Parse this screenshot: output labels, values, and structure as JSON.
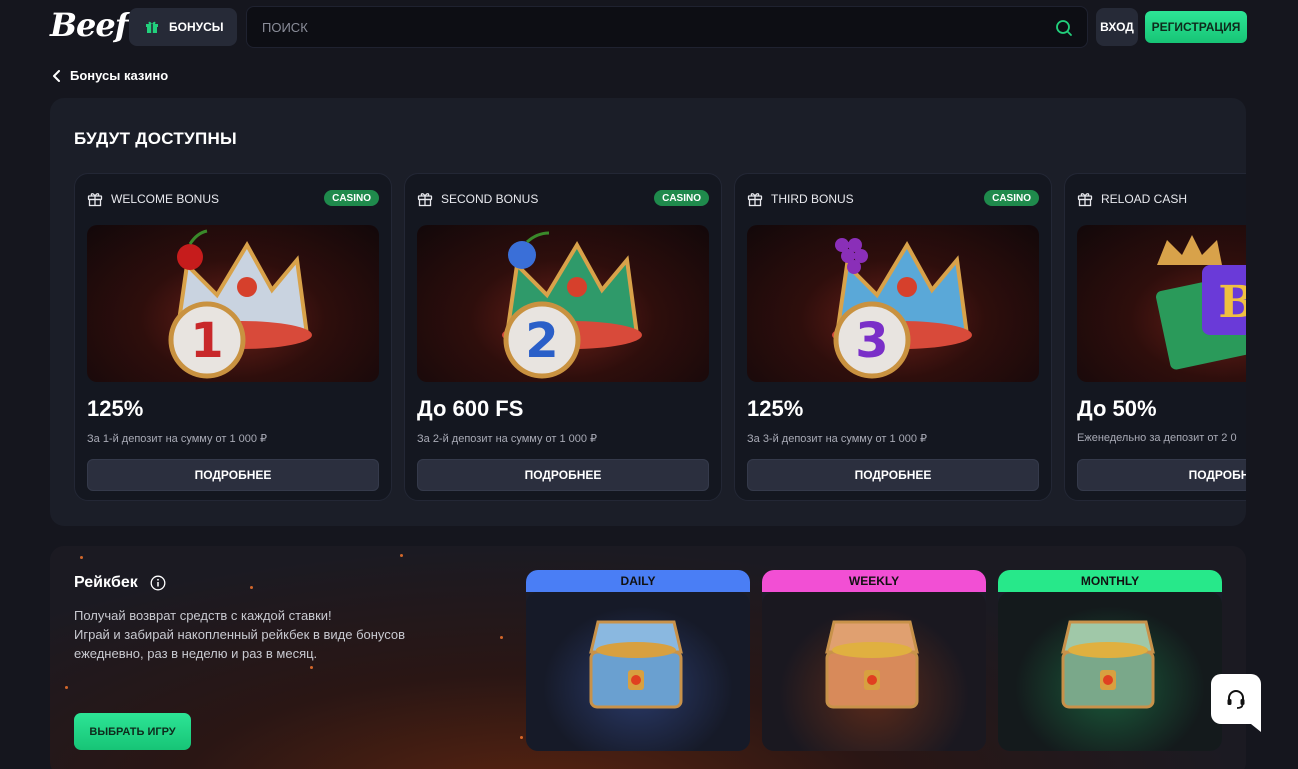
{
  "header": {
    "logo": "Beef",
    "bonuses_label": "БОНУСЫ",
    "search_placeholder": "ПОИСК",
    "login_label": "ВХОД",
    "register_label": "РЕГИСТРАЦИЯ"
  },
  "breadcrumb": {
    "back_label": "Бонусы казино"
  },
  "upcoming": {
    "title": "БУДУТ ДОСТУПНЫ",
    "cards": [
      {
        "name": "WELCOME BONUS",
        "badge": "CASINO",
        "amount": "125%",
        "desc": "За 1-й депозит на сумму от 1 000 ₽",
        "button": "ПОДРОБНЕЕ",
        "numeral": "1",
        "fruit": "cherry"
      },
      {
        "name": "SECOND BONUS",
        "badge": "CASINO",
        "amount": "До 600 FS",
        "desc": "За 2-й депозит на сумму от 1 000 ₽",
        "button": "ПОДРОБНЕЕ",
        "numeral": "2",
        "fruit": "plum"
      },
      {
        "name": "THIRD BONUS",
        "badge": "CASINO",
        "amount": "125%",
        "desc": "За 3-й депозит на сумму от 1 000 ₽",
        "button": "ПОДРОБНЕЕ",
        "numeral": "3",
        "fruit": "grapes"
      },
      {
        "name": "RELOAD CASH",
        "badge": "",
        "amount": "До 50%",
        "desc": "Еженедельно за депозит от 2 0",
        "button": "ПОДРОБНЕ",
        "numeral": "B",
        "fruit": "cash"
      }
    ]
  },
  "rakeback": {
    "title": "Рейкбек",
    "text_line1": "Получай возврат средств с каждой ставки!",
    "text_line2": "Играй и забирай накопленный рейкбек в виде бонусов",
    "text_line3": "ежедневно, раз в неделю и раз в месяц.",
    "button": "ВЫБРАТЬ ИГРУ",
    "periods": [
      {
        "label": "DAILY",
        "color": "#4a7ef5",
        "glow": "#3b6fd8"
      },
      {
        "label": "WEEKLY",
        "color": "#f24fd4",
        "glow": "#e0542a"
      },
      {
        "label": "MONTHLY",
        "color": "#27e88a",
        "glow": "#1fbf70"
      }
    ]
  },
  "colors": {
    "accent_green": "#1fd481",
    "badge_green": "#1f8a4c",
    "bg": "#15161e",
    "panel": "#1b1e28"
  }
}
